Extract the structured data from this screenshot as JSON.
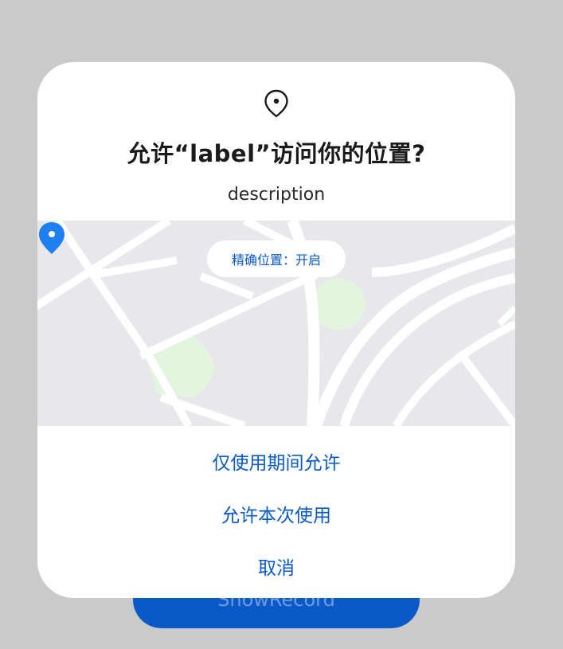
{
  "background": {
    "button_label": "ShowRecord"
  },
  "dialog": {
    "icon": "location-pin-outline-icon",
    "title": "允许“label”访问你的位置?",
    "description": "description",
    "map": {
      "precise_location_label": "精确位置：开启",
      "marker_icon": "location-pin-filled-icon"
    },
    "actions": [
      {
        "label": "仅使用期间允许"
      },
      {
        "label": "允许本次使用"
      },
      {
        "label": "取消"
      }
    ]
  },
  "colors": {
    "accent": "#0a59c9",
    "map_background": "#e8e8ec",
    "map_roads": "#ffffff",
    "map_parks": "#e3f5df",
    "marker": "#1e7ff0",
    "overlay": "#cacaca"
  }
}
